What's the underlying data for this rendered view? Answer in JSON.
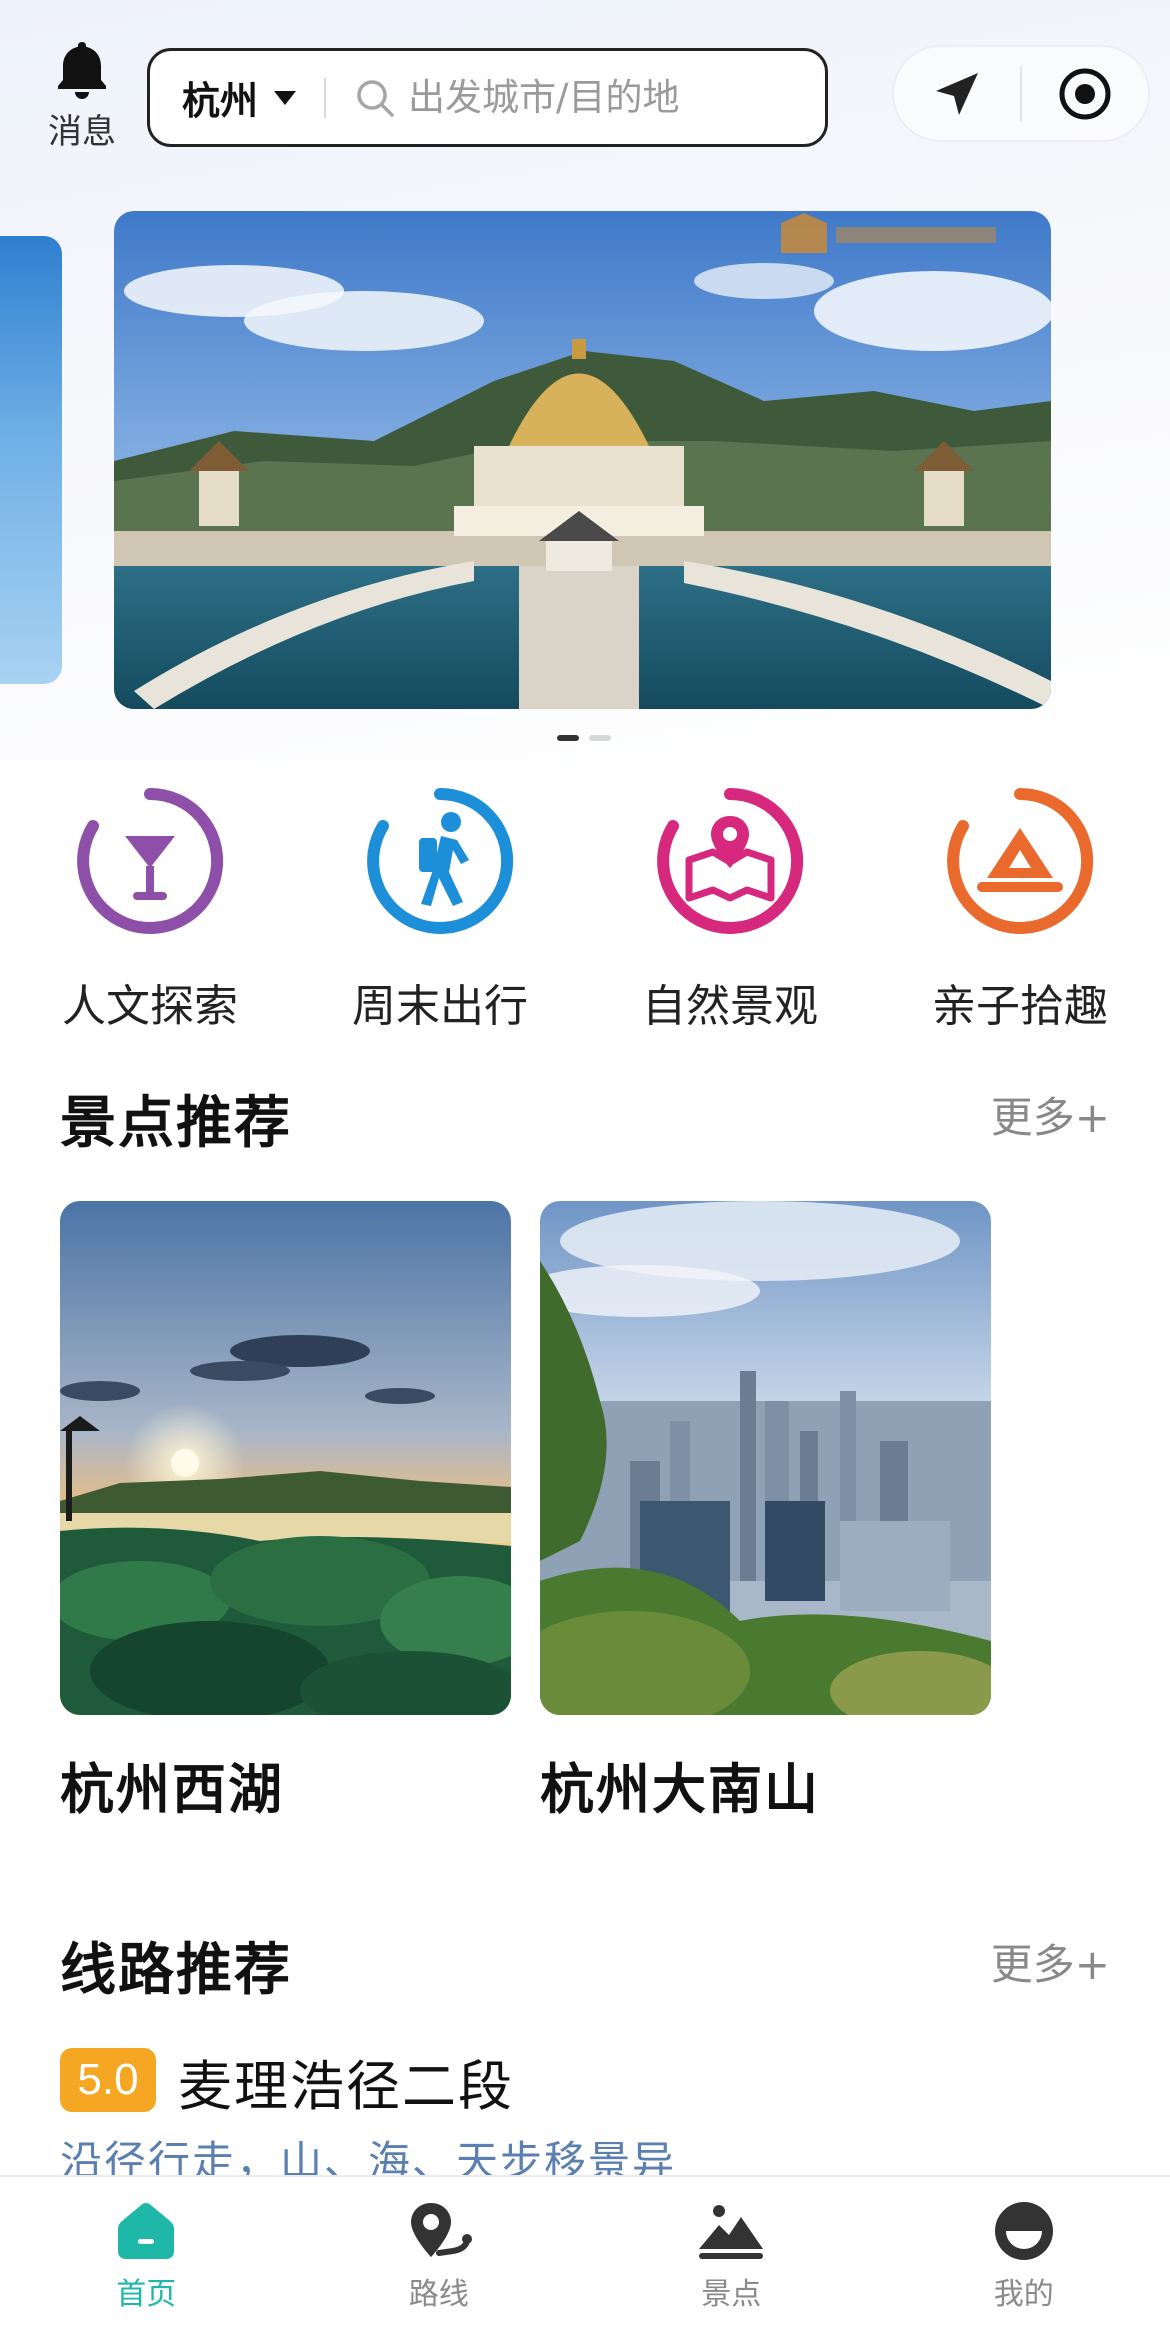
{
  "header": {
    "message_label": "消息",
    "city": "杭州",
    "search_placeholder": "出发城市/目的地"
  },
  "banner": {
    "slides": 2,
    "active_index": 0
  },
  "categories": [
    {
      "label": "人文探索",
      "icon": "cocktail-glass-icon",
      "color": "#8e4fa8"
    },
    {
      "label": "周末出行",
      "icon": "hiker-icon",
      "color": "#1d8fd8"
    },
    {
      "label": "自然景观",
      "icon": "map-pin-icon",
      "color": "#d6287d"
    },
    {
      "label": "亲子拾趣",
      "icon": "tent-icon",
      "color": "#ea6a2e"
    }
  ],
  "attractions": {
    "title": "景点推荐",
    "more": "更多+",
    "items": [
      {
        "name": "杭州西湖"
      },
      {
        "name": "杭州大南山"
      }
    ]
  },
  "routes": {
    "title": "线路推荐",
    "more": "更多+",
    "items": [
      {
        "rating": "5.0",
        "name": "麦理浩径二段",
        "desc": "沿径行走，山、海、天步移景异"
      }
    ]
  },
  "tabbar": {
    "active": "home",
    "accent": "#1fb8a8",
    "items": [
      {
        "label": "首页",
        "icon": "home-icon"
      },
      {
        "label": "路线",
        "icon": "route-icon"
      },
      {
        "label": "景点",
        "icon": "mountain-icon"
      },
      {
        "label": "我的",
        "icon": "profile-icon"
      }
    ]
  }
}
